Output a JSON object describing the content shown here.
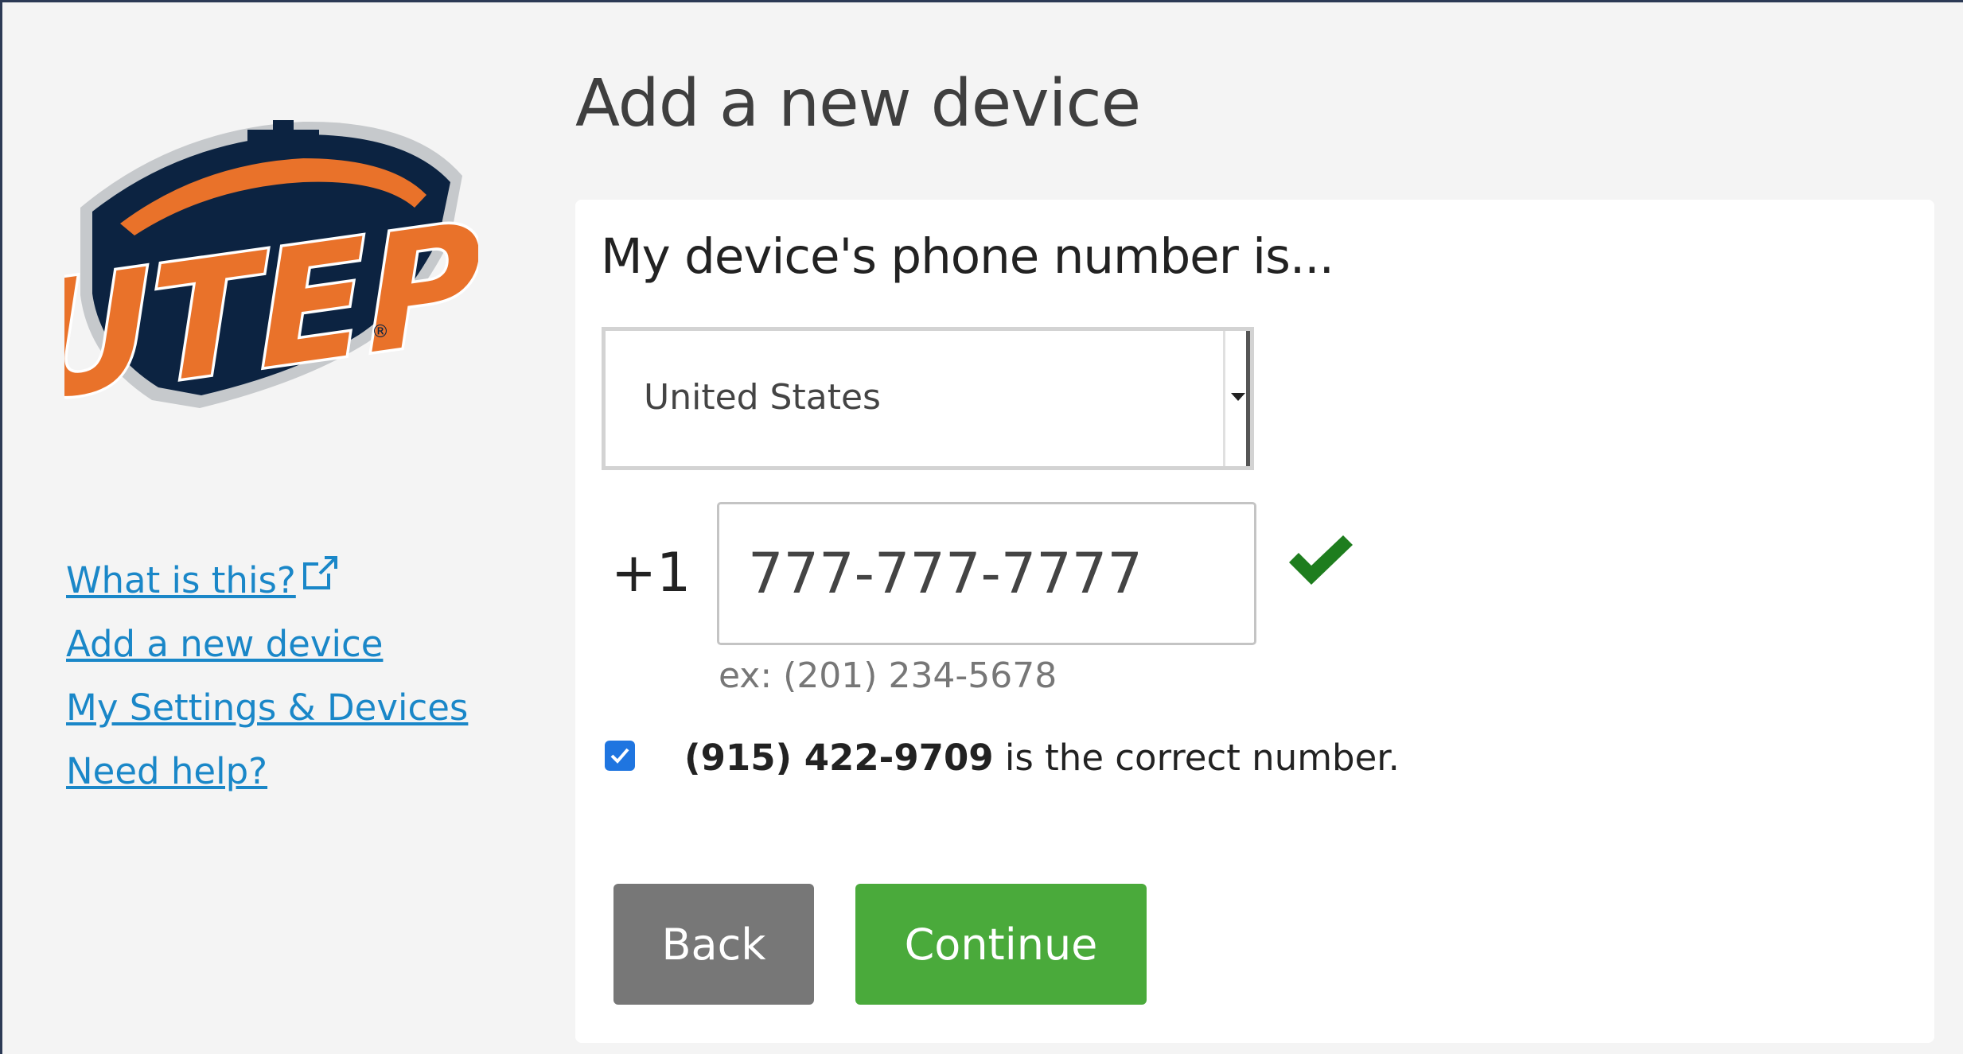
{
  "nav": {
    "what_is_this": "What is this?",
    "add_device": "Add a new device",
    "settings_devices": "My Settings & Devices",
    "need_help": "Need help?"
  },
  "logo": {
    "text": "UTEP",
    "colors": {
      "navy": "#0c2341",
      "orange": "#e9722a",
      "silver": "#c6c9cc"
    }
  },
  "main": {
    "title": "Add a new device",
    "heading": "My device's phone number is...",
    "country": {
      "selected": "United States"
    },
    "country_code": "+1",
    "phone": {
      "value": "777-777-7777"
    },
    "example": "ex: (201) 234-5678",
    "confirm": {
      "checked": true,
      "number": "(915) 422-9709",
      "suffix": " is the correct number."
    },
    "buttons": {
      "back": "Back",
      "continue": "Continue"
    }
  },
  "colors": {
    "link": "#1a87c8",
    "continue": "#4aaa3b",
    "back": "#777777",
    "valid_check": "#1e7d1e",
    "checkbox": "#1f75e0"
  },
  "icons": {
    "external_link": "external-link-icon",
    "valid": "checkmark-icon",
    "dropdown": "caret-down-icon"
  }
}
